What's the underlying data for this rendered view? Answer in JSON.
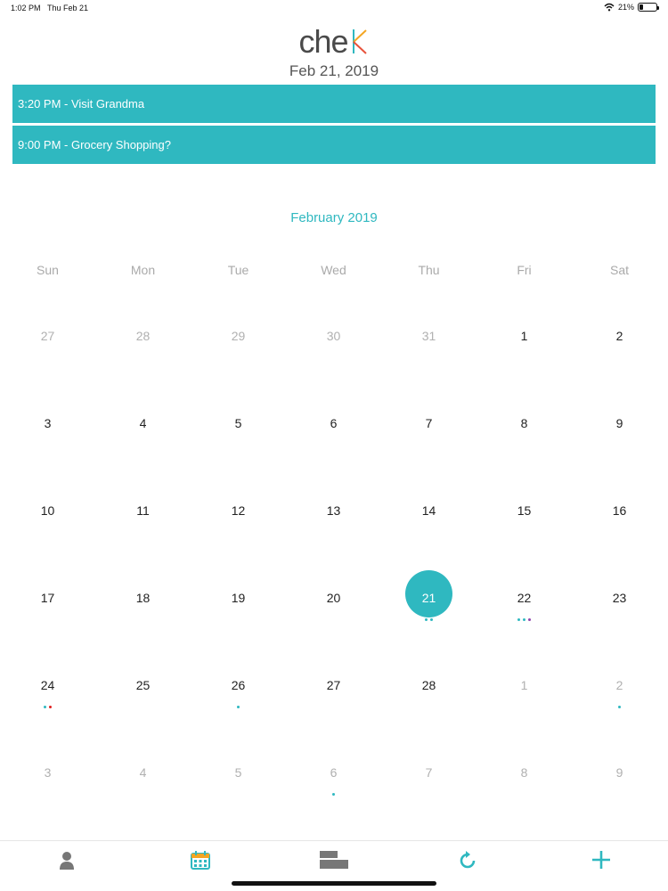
{
  "status": {
    "time": "1:02 PM",
    "date": "Thu Feb 21",
    "battery": "21%",
    "battery_level": 0.21
  },
  "logo": {
    "text_prefix": "che",
    "accent_colors": [
      "#f4a623",
      "#2fb8c0",
      "#e8523b"
    ]
  },
  "header": {
    "date": "Feb 21, 2019"
  },
  "events": [
    {
      "label": "3:20 PM - Visit Grandma"
    },
    {
      "label": "9:00 PM - Grocery Shopping?"
    }
  ],
  "calendar": {
    "month_title": "February 2019",
    "weekdays": [
      "Sun",
      "Mon",
      "Tue",
      "Wed",
      "Thu",
      "Fri",
      "Sat"
    ],
    "weeks": [
      [
        {
          "d": "27",
          "m": true
        },
        {
          "d": "28",
          "m": true
        },
        {
          "d": "29",
          "m": true
        },
        {
          "d": "30",
          "m": true
        },
        {
          "d": "31",
          "m": true
        },
        {
          "d": "1"
        },
        {
          "d": "2"
        }
      ],
      [
        {
          "d": "3"
        },
        {
          "d": "4"
        },
        {
          "d": "5"
        },
        {
          "d": "6"
        },
        {
          "d": "7"
        },
        {
          "d": "8"
        },
        {
          "d": "9"
        }
      ],
      [
        {
          "d": "10"
        },
        {
          "d": "11"
        },
        {
          "d": "12"
        },
        {
          "d": "13"
        },
        {
          "d": "14"
        },
        {
          "d": "15"
        },
        {
          "d": "16"
        }
      ],
      [
        {
          "d": "17"
        },
        {
          "d": "18"
        },
        {
          "d": "19"
        },
        {
          "d": "20"
        },
        {
          "d": "21",
          "sel": true,
          "dots": [
            "#2fb8c0",
            "#2fb8c0"
          ]
        },
        {
          "d": "22",
          "dots": [
            "#2fb8c0",
            "#2fb8c0",
            "#8e44ad"
          ]
        },
        {
          "d": "23"
        }
      ],
      [
        {
          "d": "24",
          "dots": [
            "#2fb8c0",
            "#e02020"
          ]
        },
        {
          "d": "25"
        },
        {
          "d": "26",
          "dots": [
            "#2fb8c0"
          ]
        },
        {
          "d": "27"
        },
        {
          "d": "28"
        },
        {
          "d": "1",
          "m": true
        },
        {
          "d": "2",
          "m": true,
          "dots": [
            "#2fb8c0"
          ]
        }
      ],
      [
        {
          "d": "3",
          "m": true
        },
        {
          "d": "4",
          "m": true
        },
        {
          "d": "5",
          "m": true
        },
        {
          "d": "6",
          "m": true,
          "dots": [
            "#2fb8c0"
          ]
        },
        {
          "d": "7",
          "m": true
        },
        {
          "d": "8",
          "m": true
        },
        {
          "d": "9",
          "m": true
        }
      ]
    ]
  },
  "tabs": [
    {
      "name": "tab-profile",
      "icon": "person-icon"
    },
    {
      "name": "tab-calendar",
      "icon": "calendar-icon"
    },
    {
      "name": "tab-timeline",
      "icon": "bars-icon"
    },
    {
      "name": "tab-refresh",
      "icon": "refresh-icon"
    },
    {
      "name": "tab-add",
      "icon": "plus-icon"
    }
  ],
  "colors": {
    "accent": "#2fb8c0",
    "muted": "#b0b0b0"
  }
}
